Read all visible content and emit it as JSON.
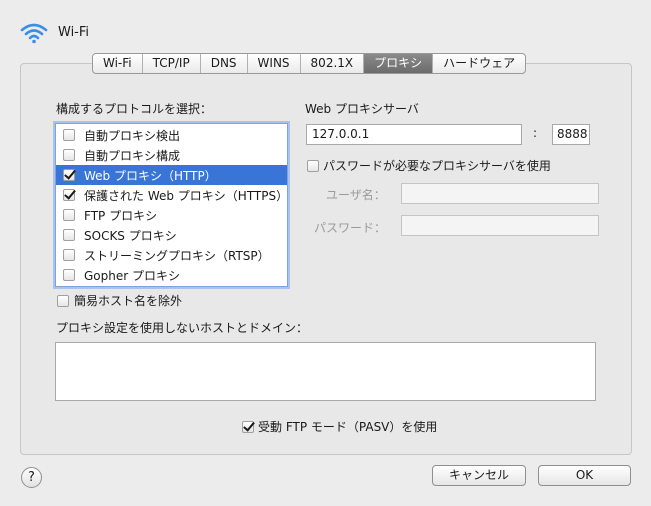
{
  "header": {
    "interface_name": "Wi-Fi",
    "icon": "wifi-icon"
  },
  "tabs": [
    {
      "label": "Wi-Fi",
      "selected": false
    },
    {
      "label": "TCP/IP",
      "selected": false
    },
    {
      "label": "DNS",
      "selected": false
    },
    {
      "label": "WINS",
      "selected": false
    },
    {
      "label": "802.1X",
      "selected": false
    },
    {
      "label": "プロキシ",
      "selected": true
    },
    {
      "label": "ハードウェア",
      "selected": false
    }
  ],
  "protocols": {
    "heading": "構成するプロトコルを選択：",
    "items": [
      {
        "label": "自動プロキシ検出",
        "checked": false,
        "selected": false
      },
      {
        "label": "自動プロキシ構成",
        "checked": false,
        "selected": false
      },
      {
        "label": "Web プロキシ（HTTP）",
        "checked": true,
        "selected": true
      },
      {
        "label": "保護された Web プロキシ（HTTPS）",
        "checked": true,
        "selected": false
      },
      {
        "label": "FTP プロキシ",
        "checked": false,
        "selected": false
      },
      {
        "label": "SOCKS プロキシ",
        "checked": false,
        "selected": false
      },
      {
        "label": "ストリーミングプロキシ（RTSP）",
        "checked": false,
        "selected": false
      },
      {
        "label": "Gopher プロキシ",
        "checked": false,
        "selected": false
      }
    ]
  },
  "exclude_simple": {
    "label": "簡易ホスト名を除外",
    "checked": false
  },
  "bypass": {
    "heading": "プロキシ設定を使用しないホストとドメイン：",
    "value": ""
  },
  "pasv": {
    "label": "受動 FTP モード（PASV）を使用",
    "checked": true
  },
  "proxy_server": {
    "heading": "Web プロキシサーバ",
    "address": "127.0.0.1",
    "separator": ":",
    "port": "8888",
    "auth_label": "パスワードが必要なプロキシサーバを使用",
    "auth_checked": false,
    "username_label": "ユーザ名：",
    "username_value": "",
    "password_label": "パスワード：",
    "password_value": ""
  },
  "footer": {
    "help": "?",
    "cancel": "キャンセル",
    "ok": "OK"
  }
}
